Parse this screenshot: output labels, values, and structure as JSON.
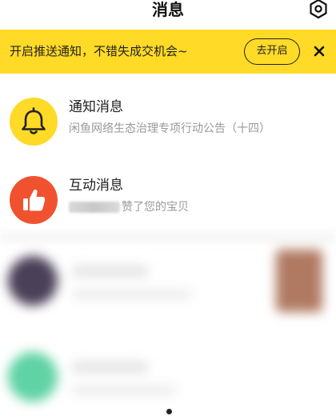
{
  "header": {
    "title": "消息",
    "settings_icon": "gear-icon"
  },
  "banner": {
    "text": "开启推送通知，不错失成交机会~",
    "button_label": "去开启",
    "close_icon": "close-icon",
    "background": "#FFDA27"
  },
  "items": [
    {
      "title": "通知消息",
      "subtitle": "闲鱼网络生态治理专项行动公告（十四）",
      "icon": "bell-icon",
      "icon_bg": "#FFDA27"
    },
    {
      "title": "互动消息",
      "subtitle": "赞了您的宝贝",
      "icon": "thumbs-up-icon",
      "icon_bg": "#F0522F"
    }
  ],
  "blurred_conversations": [
    {
      "avatar_color": "#4a4058",
      "thumb_color": "#b07a62"
    },
    {
      "avatar_color": "#5fd3a4"
    }
  ]
}
